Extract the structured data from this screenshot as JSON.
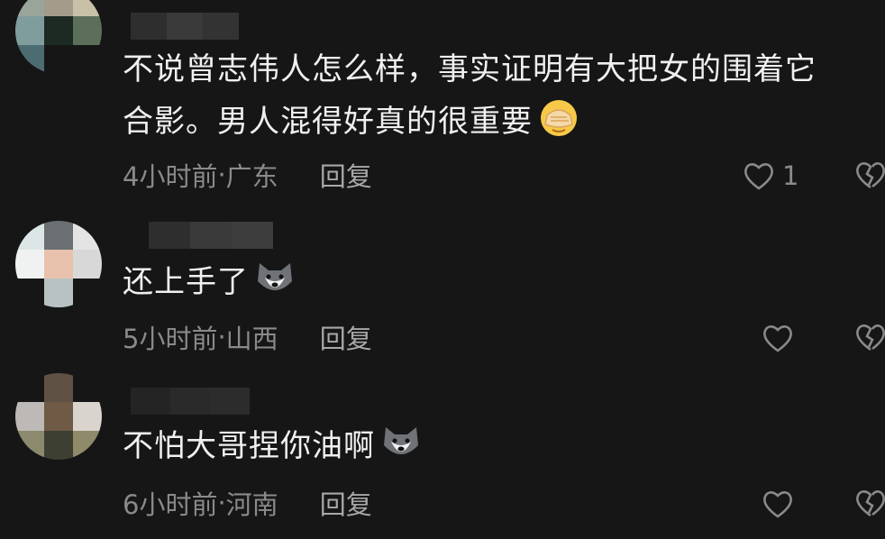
{
  "comments": [
    {
      "text_line1": "不说曾志伟人怎么样，事实证明有大把女的围着它",
      "text_line2": "合影。男人混得好真的很重要",
      "emoji": "facepalm-emoji",
      "time": "4小时前",
      "location": "广东",
      "reply_label": "回复",
      "like_count": "1"
    },
    {
      "text_line1": "还上手了",
      "emoji": "husky-emoji",
      "time": "5小时前",
      "location": "山西",
      "reply_label": "回复",
      "like_count": ""
    },
    {
      "text_line1": "不怕大哥捏你油啊",
      "emoji": "husky-emoji",
      "time": "6小时前",
      "location": "河南",
      "reply_label": "回复",
      "like_count": ""
    }
  ],
  "meta_separator": " · ",
  "colors": {
    "background": "#161616",
    "text": "#f0f0f0",
    "muted": "#8a8a8a"
  }
}
